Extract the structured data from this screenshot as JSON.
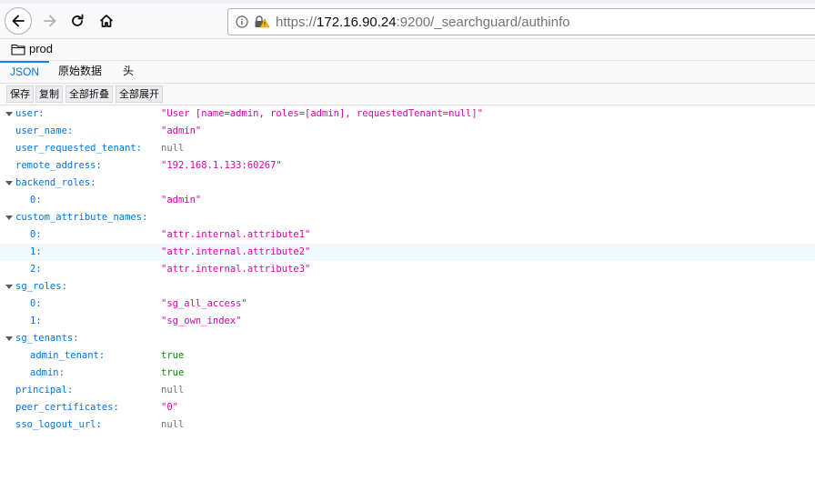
{
  "browser": {
    "url_host": "172.16.90.24",
    "url_rest": ":9200/_searchguard/authinfo",
    "url_prefix": "https://",
    "bookmark_folder": "prod"
  },
  "viewer": {
    "tabs": [
      "JSON",
      "原始数据",
      "头"
    ],
    "active_tab": "JSON",
    "toolbar": [
      "保存",
      "复制",
      "全部折叠",
      "全部展开"
    ]
  },
  "json_rows": [
    {
      "key": "user:",
      "value": "\"User [name=admin, roles=[admin], requestedTenant=null]\"",
      "type": "string",
      "depth": 0,
      "expandable": true
    },
    {
      "key": "user_name:",
      "value": "\"admin\"",
      "type": "string",
      "depth": 0
    },
    {
      "key": "user_requested_tenant:",
      "value": "null",
      "type": "null",
      "depth": 0
    },
    {
      "key": "remote_address:",
      "value": "\"192.168.1.133:60267\"",
      "type": "string",
      "depth": 0
    },
    {
      "key": "backend_roles:",
      "value": "",
      "type": "object",
      "depth": 0,
      "expandable": true
    },
    {
      "key": "0:",
      "value": "\"admin\"",
      "type": "string",
      "depth": 1
    },
    {
      "key": "custom_attribute_names:",
      "value": "",
      "type": "object",
      "depth": 0,
      "expandable": true
    },
    {
      "key": "0:",
      "value": "\"attr.internal.attribute1\"",
      "type": "string",
      "depth": 1
    },
    {
      "key": "1:",
      "value": "\"attr.internal.attribute2\"",
      "type": "string",
      "depth": 1,
      "highlighted": true
    },
    {
      "key": "2:",
      "value": "\"attr.internal.attribute3\"",
      "type": "string",
      "depth": 1
    },
    {
      "key": "sg_roles:",
      "value": "",
      "type": "object",
      "depth": 0,
      "expandable": true
    },
    {
      "key": "0:",
      "value": "\"sg_all_access\"",
      "type": "string",
      "depth": 1
    },
    {
      "key": "1:",
      "value": "\"sg_own_index\"",
      "type": "string",
      "depth": 1
    },
    {
      "key": "sg_tenants:",
      "value": "",
      "type": "object",
      "depth": 0,
      "expandable": true
    },
    {
      "key": "admin_tenant:",
      "value": "true",
      "type": "bool",
      "depth": 1
    },
    {
      "key": "admin:",
      "value": "true",
      "type": "bool",
      "depth": 1
    },
    {
      "key": "principal:",
      "value": "null",
      "type": "null",
      "depth": 0
    },
    {
      "key": "peer_certificates:",
      "value": "\"0\"",
      "type": "string",
      "depth": 0
    },
    {
      "key": "sso_logout_url:",
      "value": "null",
      "type": "null",
      "depth": 0
    }
  ],
  "colors": {
    "key": "#0074e8",
    "string": "#dd00a9",
    "null": "#737373",
    "bool": "#058b00",
    "accent": "#0a84ff"
  }
}
